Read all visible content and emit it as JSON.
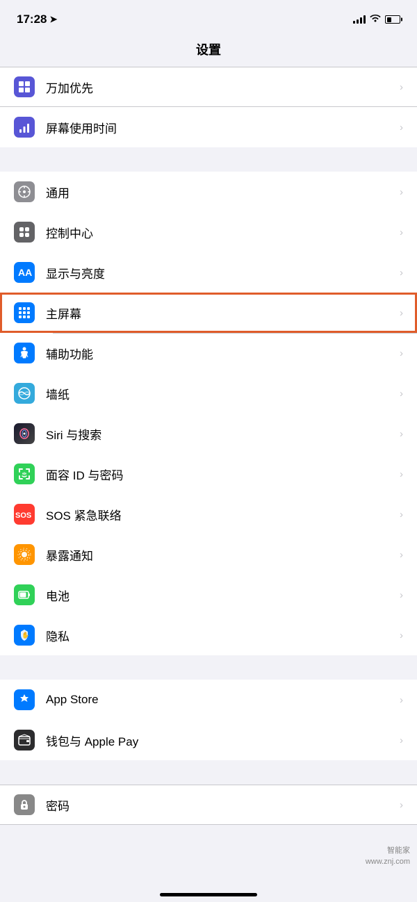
{
  "statusBar": {
    "time": "17:28",
    "locationArrow": "➤"
  },
  "pageTitle": "设置",
  "sections": [
    {
      "id": "section1",
      "items": [
        {
          "id": "screentime",
          "label": "屏幕使用时间",
          "iconClass": "icon-screentime",
          "iconType": "screentime",
          "partial": false
        }
      ]
    },
    {
      "id": "section2",
      "items": [
        {
          "id": "general",
          "label": "通用",
          "iconClass": "icon-general",
          "iconType": "general"
        },
        {
          "id": "controlcenter",
          "label": "控制中心",
          "iconClass": "icon-controlcenter",
          "iconType": "controlcenter"
        },
        {
          "id": "display",
          "label": "显示与亮度",
          "iconClass": "icon-display",
          "iconType": "display"
        },
        {
          "id": "homescreen",
          "label": "主屏幕",
          "iconClass": "icon-homescreen",
          "iconType": "homescreen",
          "highlighted": true
        },
        {
          "id": "accessibility",
          "label": "辅助功能",
          "iconClass": "icon-accessibility",
          "iconType": "accessibility"
        },
        {
          "id": "wallpaper",
          "label": "墙纸",
          "iconClass": "icon-wallpaper",
          "iconType": "wallpaper"
        },
        {
          "id": "siri",
          "label": "Siri 与搜索",
          "iconClass": "icon-siri",
          "iconType": "siri"
        },
        {
          "id": "faceid",
          "label": "面容 ID 与密码",
          "iconClass": "icon-faceid",
          "iconType": "faceid"
        },
        {
          "id": "sos",
          "label": "SOS 紧急联络",
          "iconClass": "icon-sos",
          "iconType": "sos"
        },
        {
          "id": "exposure",
          "label": "暴露通知",
          "iconClass": "icon-exposure",
          "iconType": "exposure"
        },
        {
          "id": "battery",
          "label": "电池",
          "iconClass": "icon-battery",
          "iconType": "battery"
        },
        {
          "id": "privacy",
          "label": "隐私",
          "iconClass": "icon-privacy",
          "iconType": "privacy"
        }
      ]
    },
    {
      "id": "section3",
      "items": [
        {
          "id": "appstore",
          "label": "App Store",
          "iconClass": "icon-appstore",
          "iconType": "appstore"
        },
        {
          "id": "wallet",
          "label": "钱包与 Apple Pay",
          "iconClass": "icon-wallet",
          "iconType": "wallet"
        }
      ]
    }
  ],
  "watermark": {
    "line1": "智能家",
    "line2": "www.znj.com"
  },
  "partialTopItem": {
    "label": "万加优先"
  }
}
